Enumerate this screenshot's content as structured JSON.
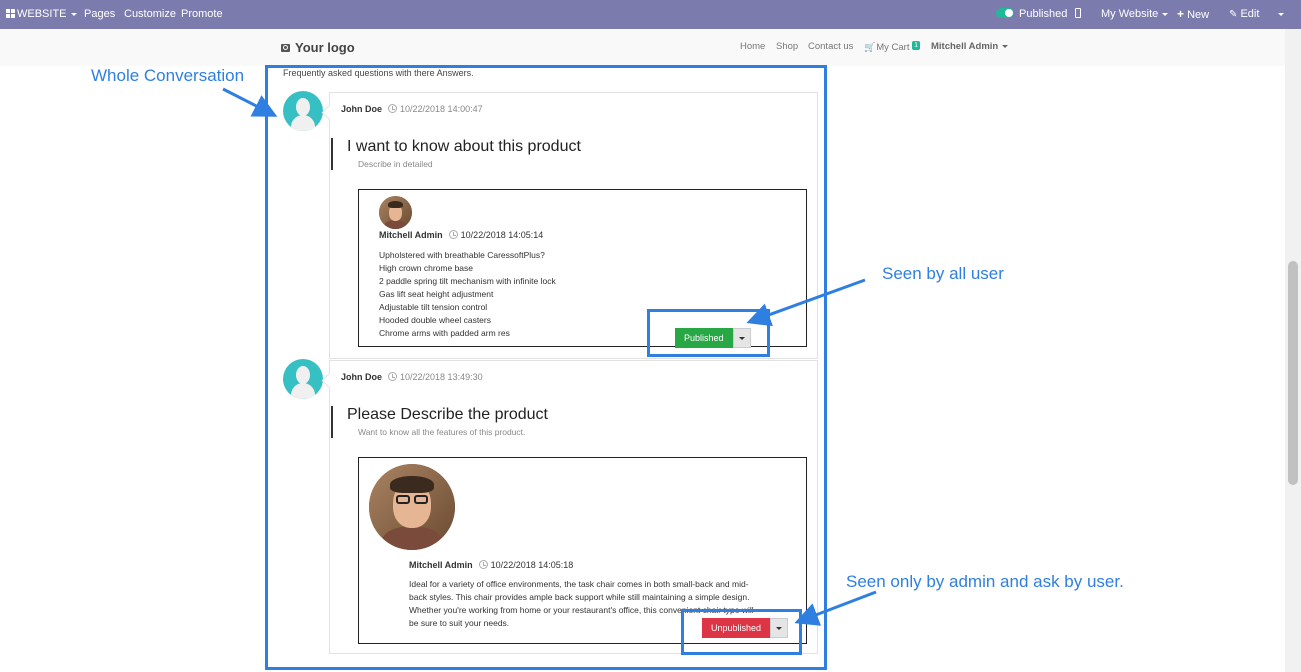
{
  "topbar": {
    "website_label": "WEBSITE",
    "pages_label": "Pages",
    "customize_label": "Customize",
    "promote_label": "Promote",
    "published_label": "Published",
    "my_website_label": "My Website",
    "new_label": "New",
    "edit_label": "Edit",
    "bar_color": "#7c7bad"
  },
  "header": {
    "logo": "Your logo",
    "nav": [
      "Home",
      "Shop",
      "Contact us"
    ],
    "cart_label": "My Cart",
    "cart_count": "1",
    "user": "Mitchell Admin"
  },
  "intro": "Frequently asked questions with there Answers.",
  "threads": [
    {
      "author": "John Doe",
      "date": "10/22/2018 14:00:47",
      "question": "I want to know about this product",
      "description": "Describe in detailed",
      "answer": {
        "author": "Mitchell Admin",
        "date": "10/22/2018 14:05:14",
        "lines": [
          "Upholstered with breathable CaressoftPlus?",
          "High crown chrome base",
          "2 paddle spring tilt mechanism with infinite lock",
          "Gas lift seat height adjustment",
          "Adjustable tilt tension control",
          "Hooded double wheel casters",
          "Chrome arms with padded arm res"
        ],
        "status": "Published",
        "status_color": "#28a745"
      }
    },
    {
      "author": "John Doe",
      "date": "10/22/2018 13:49:30",
      "question": "Please Describe the product",
      "description": "Want to know all the features of this product.",
      "answer": {
        "author": "Mitchell Admin",
        "date": "10/22/2018 14:05:18",
        "lines": [
          "Ideal for a variety of office environments, the task chair comes in both small-back and mid-",
          "back styles. This chair provides ample back support while still maintaining a simple design.",
          "Whether you're working from home or your restaurant's office, this convenient chair type will",
          "be sure to suit your needs."
        ],
        "status": "Unpublished",
        "status_color": "#dc3545"
      }
    }
  ],
  "annotations": {
    "whole_conversation": "Whole Conversation",
    "seen_by_all": "Seen by all user",
    "seen_only_admin": "Seen only by admin and ask by user.",
    "color": "#2f7fe0"
  }
}
